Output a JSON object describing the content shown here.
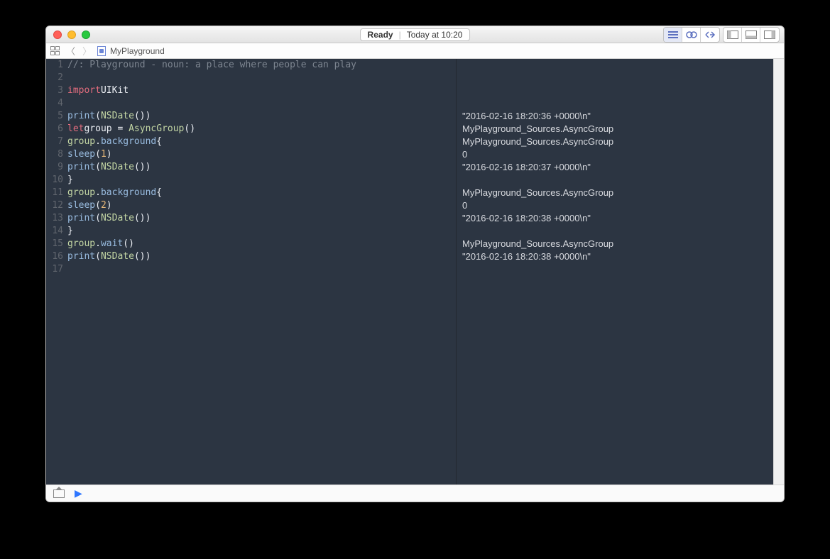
{
  "titlebar": {
    "status_label": "Ready",
    "status_time": "Today at 10:20"
  },
  "navbar": {
    "doc_name": "MyPlayground"
  },
  "code": {
    "lines": [
      {
        "n": "1",
        "html": "<span class='c-comment'>//: Playground - noun: a place where people can play</span>"
      },
      {
        "n": "2",
        "html": ""
      },
      {
        "n": "3",
        "html": "<span class='c-kw'>import</span> <span class='c-white'>UIKit</span>"
      },
      {
        "n": "4",
        "html": ""
      },
      {
        "n": "5",
        "html": "<span class='c-call'>print</span><span class='c-white'>(</span><span class='c-type'>NSDate</span><span class='c-white'>())</span>"
      },
      {
        "n": "6",
        "html": "<span class='c-kw'>let</span> <span class='c-white'>group = </span><span class='c-type'>AsyncGroup</span><span class='c-white'>()</span>"
      },
      {
        "n": "7",
        "html": "<span class='c-prop'>group</span><span class='c-white'>.</span><span class='c-call'>background</span> <span class='c-white'>{</span>"
      },
      {
        "n": "8",
        "html": "    <span class='c-call'>sleep</span><span class='c-white'>(</span><span class='c-num'>1</span><span class='c-white'>)</span>"
      },
      {
        "n": "9",
        "html": "    <span class='c-call'>print</span><span class='c-white'>(</span><span class='c-type'>NSDate</span><span class='c-white'>())</span>"
      },
      {
        "n": "10",
        "html": "<span class='c-white'>}</span>"
      },
      {
        "n": "11",
        "html": "<span class='c-prop'>group</span><span class='c-white'>.</span><span class='c-call'>background</span> <span class='c-white'>{</span>"
      },
      {
        "n": "12",
        "html": "    <span class='c-call'>sleep</span><span class='c-white'>(</span><span class='c-num'>2</span><span class='c-white'>)</span>"
      },
      {
        "n": "13",
        "html": "    <span class='c-call'>print</span><span class='c-white'>(</span><span class='c-type'>NSDate</span><span class='c-white'>())</span>"
      },
      {
        "n": "14",
        "html": "<span class='c-white'>}</span>"
      },
      {
        "n": "15",
        "html": "<span class='c-prop'>group</span><span class='c-white'>.</span><span class='c-call'>wait</span><span class='c-white'>()</span>"
      },
      {
        "n": "16",
        "html": "<span class='c-call'>print</span><span class='c-white'>(</span><span class='c-type'>NSDate</span><span class='c-white'>())</span>"
      },
      {
        "n": "17",
        "html": ""
      }
    ]
  },
  "results": {
    "lines": [
      "",
      "",
      "",
      "",
      "\"2016-02-16 18:20:36 +0000\\n\"",
      "MyPlayground_Sources.AsyncGroup",
      "MyPlayground_Sources.AsyncGroup",
      "0",
      "\"2016-02-16 18:20:37 +0000\\n\"",
      "",
      "MyPlayground_Sources.AsyncGroup",
      "0",
      "\"2016-02-16 18:20:38 +0000\\n\"",
      "",
      "MyPlayground_Sources.AsyncGroup",
      "\"2016-02-16 18:20:38 +0000\\n\"",
      ""
    ]
  }
}
